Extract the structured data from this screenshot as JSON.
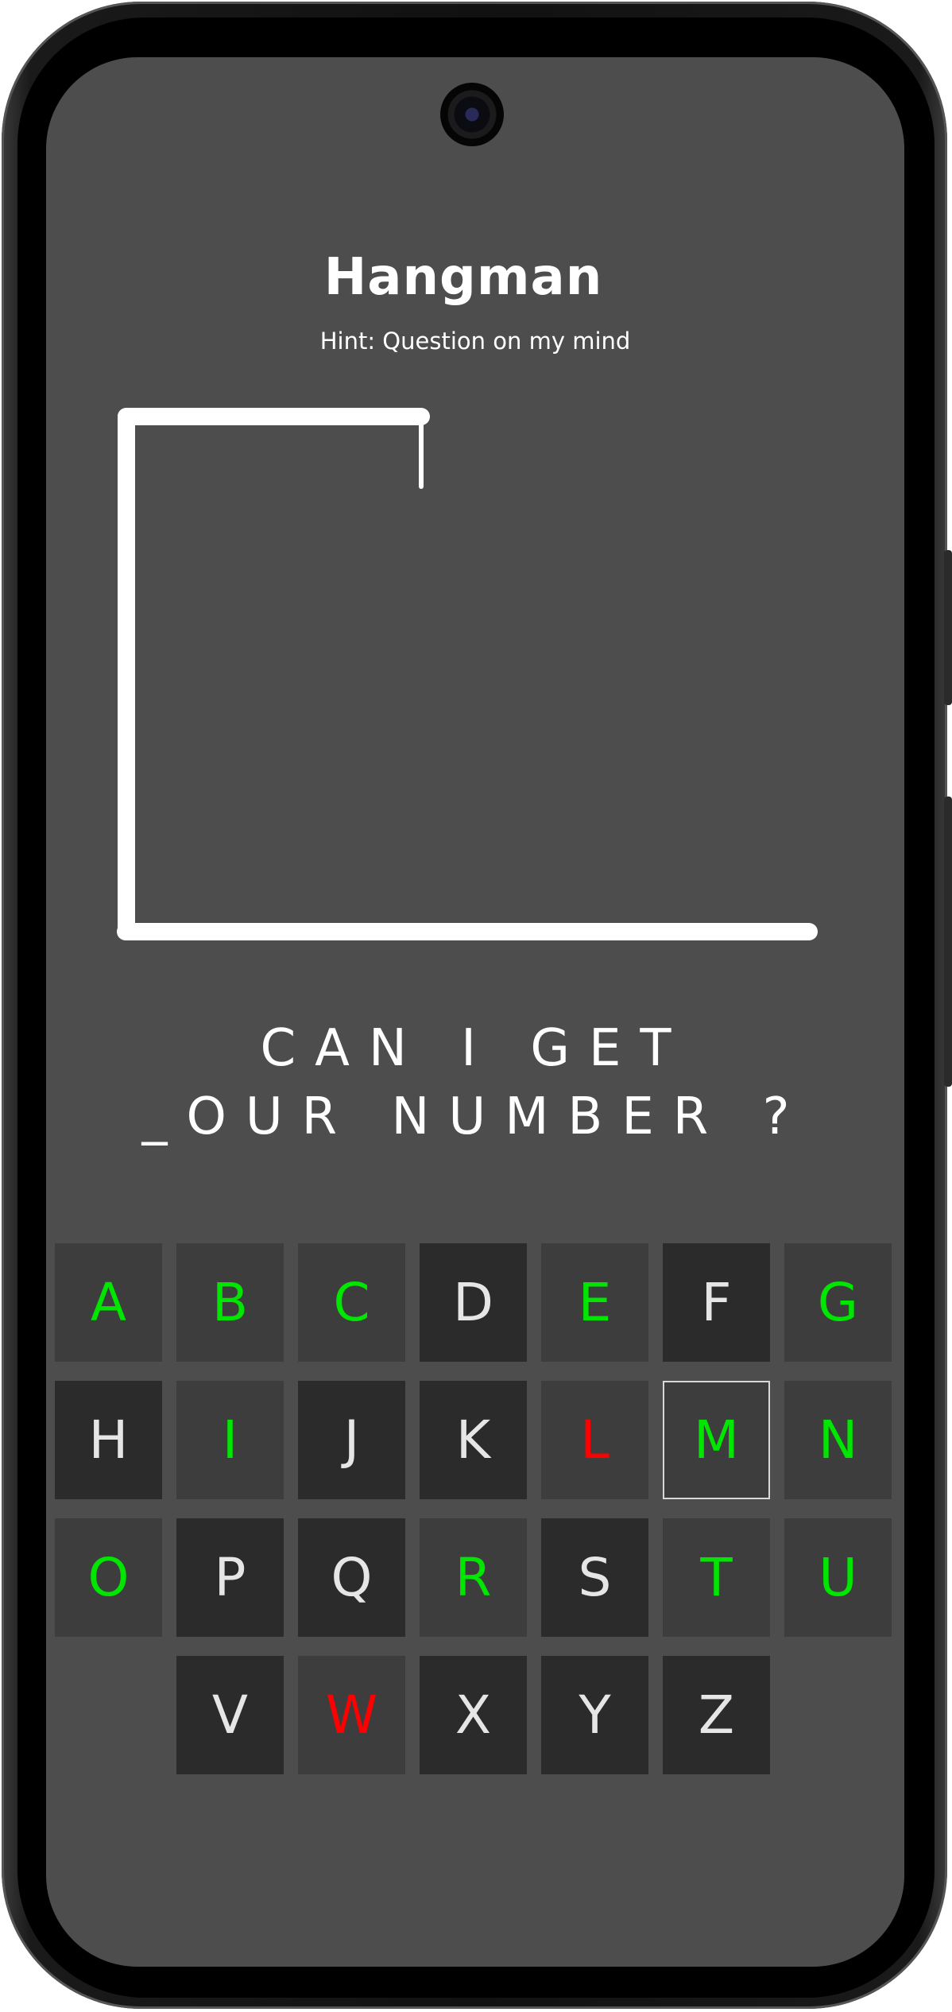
{
  "app": {
    "title": "Hangman",
    "hint": "Hint: Question on my mind"
  },
  "phrase": {
    "line1": "CAN I GET",
    "line2": "_OUR NUMBER ?"
  },
  "colors": {
    "background": "#4d4d4d",
    "correct": "#00e600",
    "wrong": "#ff0000",
    "key_used": "#3d3d3d",
    "key_unused": "#2b2b2b",
    "text": "#ffffff"
  },
  "keyboard": {
    "keys": [
      {
        "letter": "A",
        "state": "correct"
      },
      {
        "letter": "B",
        "state": "correct"
      },
      {
        "letter": "C",
        "state": "correct"
      },
      {
        "letter": "D",
        "state": "unused"
      },
      {
        "letter": "E",
        "state": "correct"
      },
      {
        "letter": "F",
        "state": "unused"
      },
      {
        "letter": "G",
        "state": "correct"
      },
      {
        "letter": "H",
        "state": "unused"
      },
      {
        "letter": "I",
        "state": "correct"
      },
      {
        "letter": "J",
        "state": "unused"
      },
      {
        "letter": "K",
        "state": "unused"
      },
      {
        "letter": "L",
        "state": "wrong"
      },
      {
        "letter": "M",
        "state": "correct",
        "selected": true
      },
      {
        "letter": "N",
        "state": "correct"
      },
      {
        "letter": "O",
        "state": "correct"
      },
      {
        "letter": "P",
        "state": "unused"
      },
      {
        "letter": "Q",
        "state": "unused"
      },
      {
        "letter": "R",
        "state": "correct"
      },
      {
        "letter": "S",
        "state": "unused"
      },
      {
        "letter": "T",
        "state": "correct"
      },
      {
        "letter": "U",
        "state": "correct"
      },
      {
        "letter": "V",
        "state": "unused"
      },
      {
        "letter": "W",
        "state": "wrong"
      },
      {
        "letter": "X",
        "state": "unused"
      },
      {
        "letter": "Y",
        "state": "unused"
      },
      {
        "letter": "Z",
        "state": "unused"
      }
    ]
  },
  "icons": {
    "camera": "front-camera-icon",
    "gallows": "gallows-icon"
  }
}
